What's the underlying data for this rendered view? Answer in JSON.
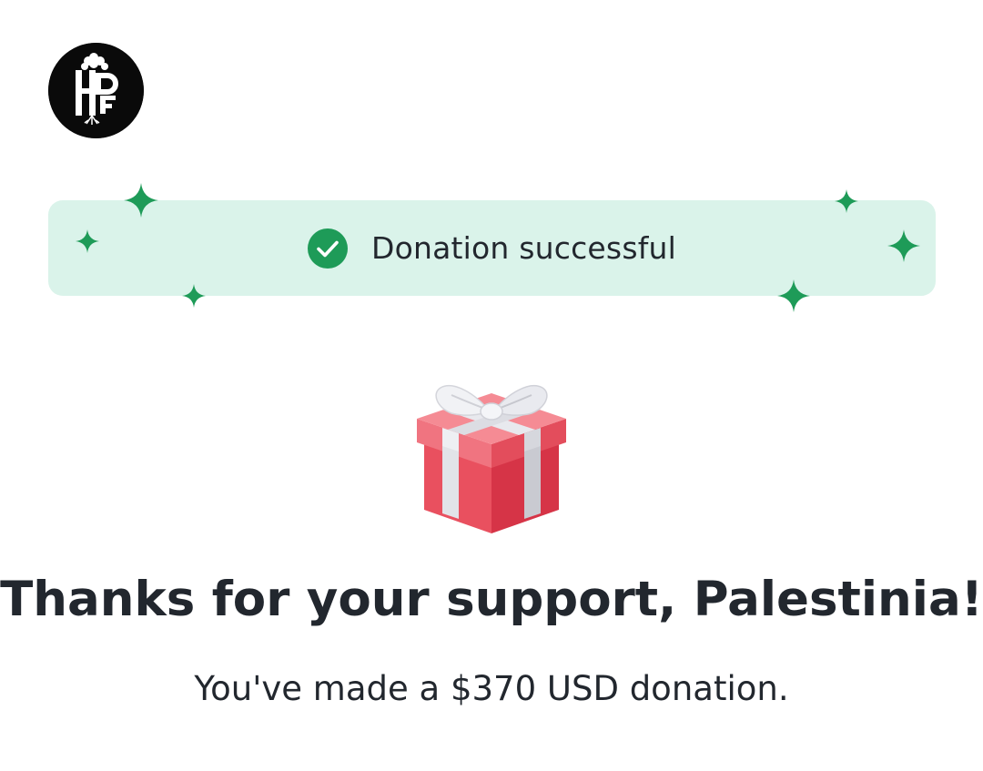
{
  "logo": {
    "icon": "hpf-logo-icon",
    "text": "HPF"
  },
  "banner": {
    "message": "Donation successful",
    "check_icon": "check-circle-icon",
    "accent_color": "#1e9b58",
    "background_color": "#daf3ea"
  },
  "gift": {
    "icon": "gift-box-icon"
  },
  "thanks": {
    "title": "Thanks for your support, Palestinia!",
    "subtitle": "You've made a $370 USD donation."
  }
}
